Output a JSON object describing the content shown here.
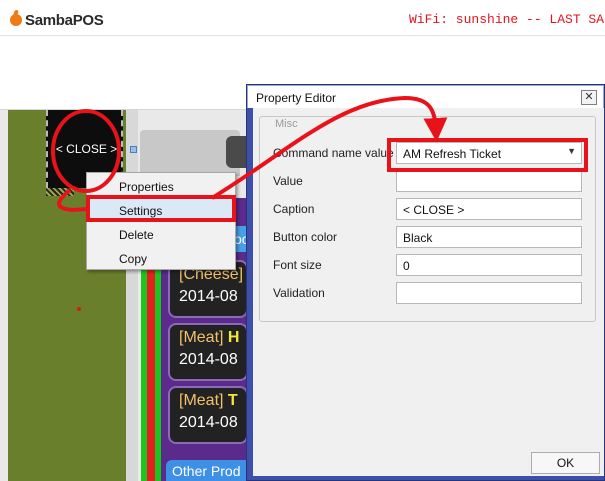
{
  "header": {
    "logo_text": "SambaPOS",
    "status_text": "WiFi: sunshine -- LAST SALE"
  },
  "pos": {
    "close_button_label": "< CLOSE >",
    "products": [
      {
        "category": "[Cheese]",
        "name": "",
        "date": "2014-08"
      },
      {
        "category": "[Meat]",
        "name": "H",
        "date": "2014-08"
      },
      {
        "category": "[Meat]",
        "name": "T",
        "date": "2014-08"
      }
    ],
    "other_products_label": "Other Prod",
    "blue_tab_text": "oo"
  },
  "context_menu": {
    "items": [
      {
        "label": "Properties"
      },
      {
        "label": "Settings"
      },
      {
        "label": "Delete"
      },
      {
        "label": "Copy"
      }
    ]
  },
  "property_editor": {
    "title": "Property Editor",
    "close_glyph": "✕",
    "group_label": "Misc",
    "fields": [
      {
        "label": "Command name value",
        "value": "AM Refresh Ticket"
      },
      {
        "label": "Value",
        "value": ""
      },
      {
        "label": "Caption",
        "value": "< CLOSE >"
      },
      {
        "label": "Button color",
        "value": "Black"
      },
      {
        "label": "Font size",
        "value": "0"
      },
      {
        "label": "Validation",
        "value": ""
      }
    ],
    "ok_label": "OK"
  },
  "colors": {
    "annotation_red": "#e8131a",
    "dialog_border_blue": "#3d4fa8",
    "olive_panel": "#6a7f2c",
    "purple_panel": "#5a2a8c"
  }
}
